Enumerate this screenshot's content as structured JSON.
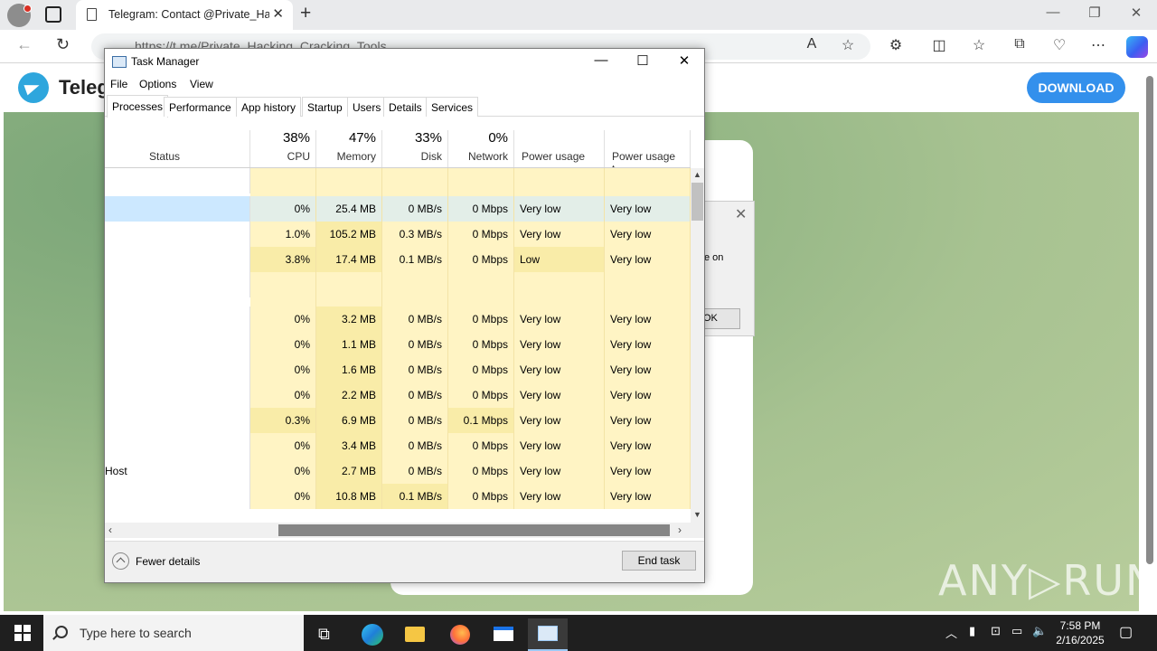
{
  "browser": {
    "tab_title": "Telegram: Contact @Private_Hacking_Cracking_Tools",
    "url": "https://t.me/Private_Hacking_Cracking_Tools",
    "window_controls": [
      "—",
      "❐",
      "✕"
    ]
  },
  "telegram": {
    "brand": "Telegram",
    "download_label": "DOWNLOAD",
    "dialog_text": "e on",
    "dialog_ok": "OK",
    "watermark": "ANY▷RUN"
  },
  "task_manager": {
    "title": "Task Manager",
    "menu": [
      "File",
      "Options",
      "View"
    ],
    "tabs": [
      "Processes",
      "Performance",
      "App history",
      "Startup",
      "Users",
      "Details",
      "Services"
    ],
    "active_tab": "Processes",
    "columns": [
      {
        "pct": "",
        "label": "Status"
      },
      {
        "pct": "38%",
        "label": "CPU"
      },
      {
        "pct": "47%",
        "label": "Memory"
      },
      {
        "pct": "33%",
        "label": "Disk"
      },
      {
        "pct": "0%",
        "label": "Network"
      },
      {
        "pct": "",
        "label": "Power usage"
      },
      {
        "pct": "",
        "label": "Power usage t..."
      }
    ],
    "rows": [
      {
        "name": "",
        "cpu": "",
        "memory": "",
        "disk": "",
        "network": "",
        "power": "",
        "power_trend": ""
      },
      {
        "name": "",
        "cpu": "0%",
        "memory": "25.4 MB",
        "disk": "0 MB/s",
        "network": "0 Mbps",
        "power": "Very low",
        "power_trend": "Very low"
      },
      {
        "name": "",
        "cpu": "1.0%",
        "memory": "105.2 MB",
        "disk": "0.3 MB/s",
        "network": "0 Mbps",
        "power": "Very low",
        "power_trend": "Very low"
      },
      {
        "name": "",
        "cpu": "3.8%",
        "memory": "17.4 MB",
        "disk": "0.1 MB/s",
        "network": "0 Mbps",
        "power": "Low",
        "power_trend": "Very low"
      },
      {
        "name": "",
        "cpu": "",
        "memory": "",
        "disk": "",
        "network": "",
        "power": "",
        "power_trend": ""
      },
      {
        "name": "",
        "cpu": "0%",
        "memory": "3.2 MB",
        "disk": "0 MB/s",
        "network": "0 Mbps",
        "power": "Very low",
        "power_trend": "Very low"
      },
      {
        "name": "",
        "cpu": "0%",
        "memory": "1.1 MB",
        "disk": "0 MB/s",
        "network": "0 Mbps",
        "power": "Very low",
        "power_trend": "Very low"
      },
      {
        "name": "",
        "cpu": "0%",
        "memory": "1.6 MB",
        "disk": "0 MB/s",
        "network": "0 Mbps",
        "power": "Very low",
        "power_trend": "Very low"
      },
      {
        "name": "",
        "cpu": "0%",
        "memory": "2.2 MB",
        "disk": "0 MB/s",
        "network": "0 Mbps",
        "power": "Very low",
        "power_trend": "Very low"
      },
      {
        "name": "",
        "cpu": "0.3%",
        "memory": "6.9 MB",
        "disk": "0 MB/s",
        "network": "0.1 Mbps",
        "power": "Very low",
        "power_trend": "Very low"
      },
      {
        "name": "",
        "cpu": "0%",
        "memory": "3.4 MB",
        "disk": "0 MB/s",
        "network": "0 Mbps",
        "power": "Very low",
        "power_trend": "Very low"
      },
      {
        "name": "Host",
        "cpu": "0%",
        "memory": "2.7 MB",
        "disk": "0 MB/s",
        "network": "0 Mbps",
        "power": "Very low",
        "power_trend": "Very low"
      },
      {
        "name": "",
        "cpu": "0%",
        "memory": "10.8 MB",
        "disk": "0.1 MB/s",
        "network": "0 Mbps",
        "power": "Very low",
        "power_trend": "Very low"
      }
    ],
    "fewer_details": "Fewer details",
    "end_task": "End task"
  },
  "taskbar": {
    "search_placeholder": "Type here to search",
    "time": "7:58 PM",
    "date": "2/16/2025"
  },
  "colors": {
    "heat_low": "#fff4c4",
    "heat_mid": "#f9eca8",
    "selected_row": "#cce8ff",
    "telegram_blue": "#3390ec"
  }
}
